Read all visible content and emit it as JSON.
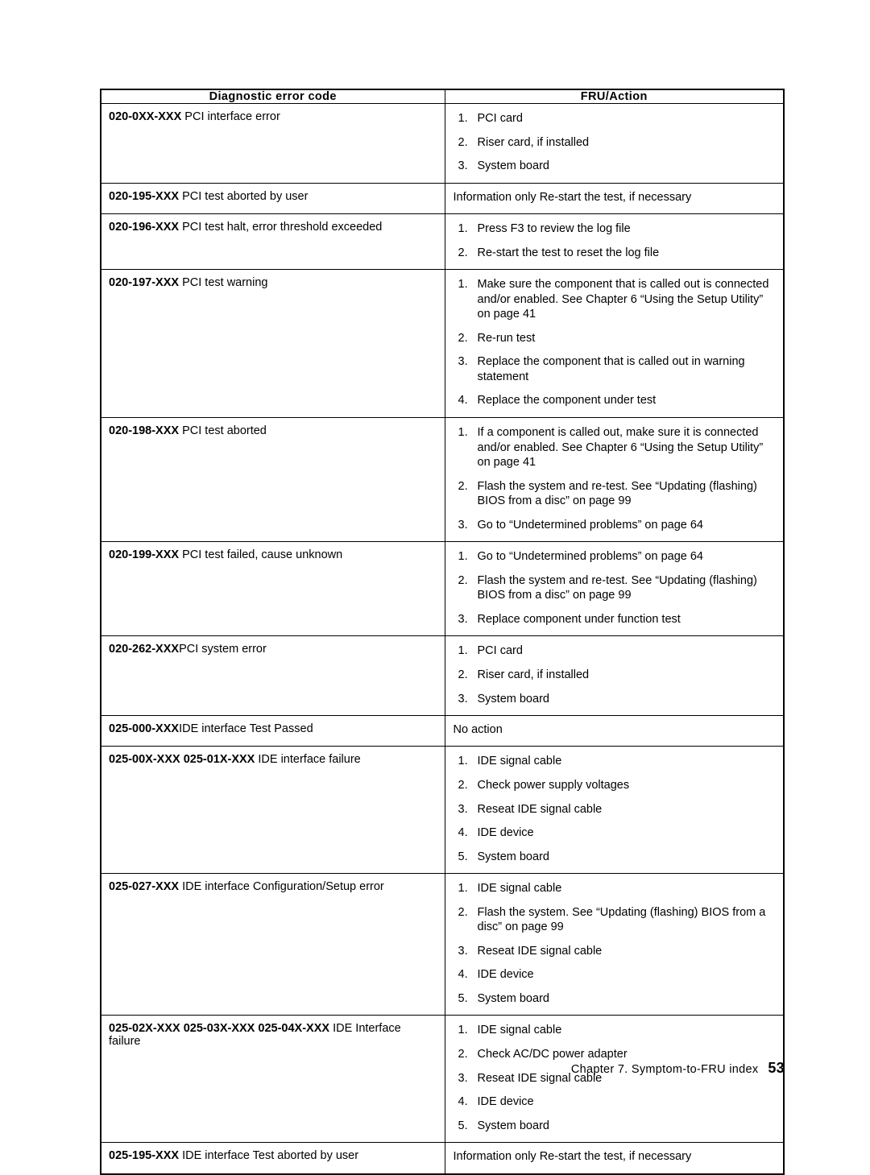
{
  "document": {
    "footer": {
      "chapter_text": "Chapter 7. Symptom-to-FRU index",
      "page_number": "53"
    }
  },
  "table": {
    "headers": {
      "col1": "Diagnostic error code",
      "col2": "FRU/Action"
    },
    "rows": [
      {
        "code": "020-0XX-XXX",
        "separator": " ",
        "description": "PCI interface error",
        "actions": [
          "PCI card",
          "Riser card, if installed",
          "System board"
        ],
        "plain": null
      },
      {
        "code": "020-195-XXX",
        "separator": " ",
        "description": "PCI test aborted by user",
        "actions": null,
        "plain": "Information only Re-start the test, if necessary"
      },
      {
        "code": "020-196-XXX",
        "separator": " ",
        "description": "PCI test halt, error threshold exceeded",
        "actions": [
          "Press F3 to review the log file",
          "Re-start the test to reset the log file"
        ],
        "plain": null
      },
      {
        "code": "020-197-XXX",
        "separator": " ",
        "description": "PCI test warning",
        "actions": [
          "Make sure the component that is called out is connected and/or enabled. See Chapter 6 “Using the Setup Utility” on page 41",
          "Re-run test",
          "Replace the component that is called out in warning statement",
          "Replace the component under test"
        ],
        "plain": null
      },
      {
        "code": "020-198-XXX",
        "separator": " ",
        "description": "PCI test aborted",
        "actions": [
          "If a component is called out, make sure it is connected and/or enabled. See Chapter 6 “Using the Setup Utility” on page 41",
          "Flash the system and re-test.  See “Updating (flashing) BIOS from a disc” on page 99",
          "Go to “Undetermined problems” on page 64"
        ],
        "plain": null
      },
      {
        "code": "020-199-XXX",
        "separator": " ",
        "description": "PCI test failed, cause unknown",
        "actions": [
          "Go to “Undetermined problems” on page 64",
          "Flash the system and re-test.  See “Updating (flashing) BIOS from a disc” on page 99",
          "Replace component under function test"
        ],
        "plain": null
      },
      {
        "code": "020-262-XXX",
        "separator": "",
        "description": "PCI system error",
        "actions": [
          "PCI card",
          "Riser card, if installed",
          "System board"
        ],
        "plain": null
      },
      {
        "code": "025-000-XXX",
        "separator": "",
        "description": "IDE interface Test Passed",
        "actions": null,
        "plain": "No action"
      },
      {
        "code": "025-00X-XXX 025-01X-XXX",
        "separator": " ",
        "description": "IDE interface failure",
        "actions": [
          "IDE signal cable",
          "Check power supply voltages",
          "Reseat IDE signal cable",
          "IDE device",
          "System board"
        ],
        "plain": null
      },
      {
        "code": "025-027-XXX",
        "separator": " ",
        "description": "IDE interface Configuration/Setup error",
        "actions": [
          "IDE signal cable",
          "Flash the system.  See “Updating (flashing) BIOS from a disc” on page 99",
          "Reseat IDE signal cable",
          "IDE device",
          "System board"
        ],
        "plain": null
      },
      {
        "code": "025-02X-XXX 025-03X-XXX 025-04X-XXX",
        "separator": " ",
        "description": "IDE Interface failure",
        "actions": [
          "IDE signal cable",
          "Check AC/DC power adapter",
          "Reseat IDE signal cable",
          "IDE device",
          "System board"
        ],
        "plain": null
      },
      {
        "code": "025-195-XXX",
        "separator": " ",
        "description": "IDE interface Test aborted by user",
        "actions": null,
        "plain": "Information only Re-start the test, if necessary"
      }
    ]
  }
}
